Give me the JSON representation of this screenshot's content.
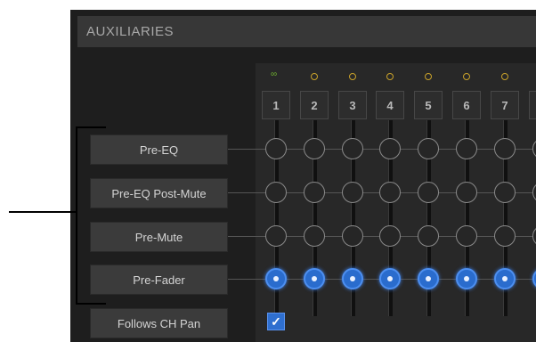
{
  "panel": {
    "title": "AUXILIARIES"
  },
  "buttons": [
    {
      "label": "Pre-EQ"
    },
    {
      "label": "Pre-EQ Post-Mute"
    },
    {
      "label": "Pre-Mute"
    },
    {
      "label": "Pre-Fader"
    },
    {
      "label": "Follows CH Pan"
    }
  ],
  "channels": [
    {
      "number": "1",
      "indicator": "stereo-link-icon"
    },
    {
      "number": "2",
      "indicator": "mono-ring-icon"
    },
    {
      "number": "3",
      "indicator": "mono-ring-icon"
    },
    {
      "number": "4",
      "indicator": "mono-ring-icon"
    },
    {
      "number": "5",
      "indicator": "mono-ring-icon"
    },
    {
      "number": "6",
      "indicator": "mono-ring-icon"
    },
    {
      "number": "7",
      "indicator": "mono-ring-icon"
    }
  ],
  "tap_points": {
    "selected": "Pre-Fader"
  },
  "follows_pan_checked": true,
  "colors": {
    "selected_node": "#2a6ccd",
    "stereo_indicator": "#6fb230",
    "mono_indicator": "#c9a22a"
  },
  "glyphs": {
    "stereo": "∞",
    "check": "✓"
  }
}
